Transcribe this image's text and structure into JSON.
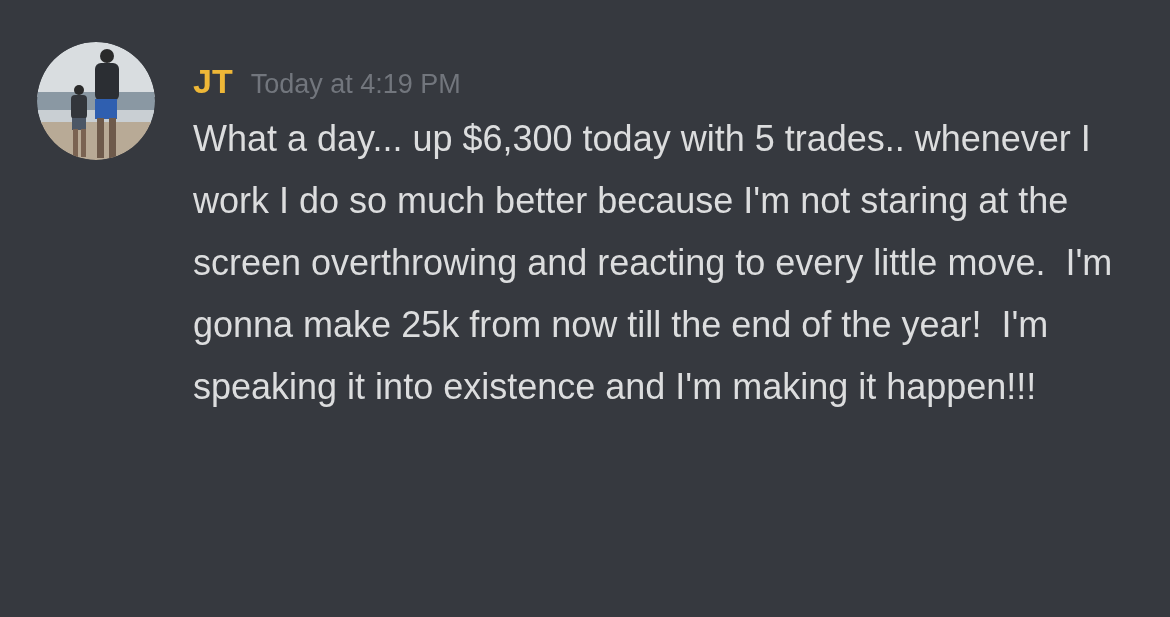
{
  "message": {
    "author": "JT",
    "timestamp": "Today at 4:19 PM",
    "text": "What a day... up $6,300 today with 5 trades.. whenever I work I do so much better because I'm not staring at the screen overthrowing and reacting to every little move.  I'm gonna make 25k from now till the end of the year!  I'm speaking it into existence and I'm making it happen!!!"
  }
}
